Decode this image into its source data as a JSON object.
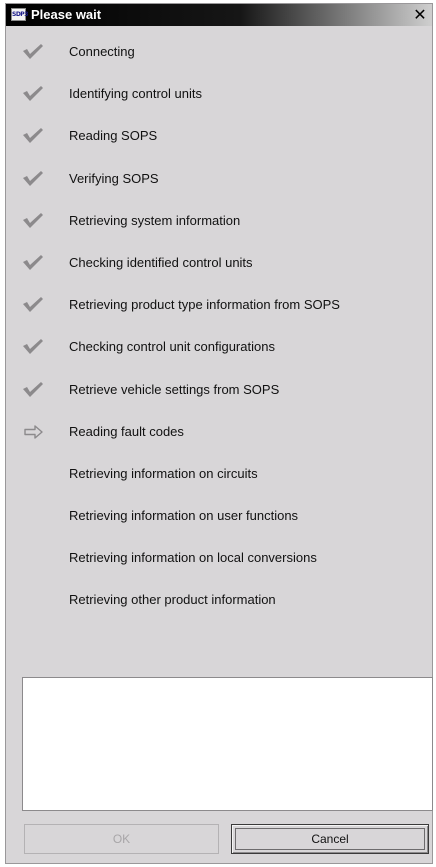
{
  "dialog": {
    "title": "Please wait",
    "app_icon_text": "SDP3",
    "close_glyph": "✕"
  },
  "steps": [
    {
      "label": "Connecting",
      "status": "done"
    },
    {
      "label": "Identifying control units",
      "status": "done"
    },
    {
      "label": "Reading SOPS",
      "status": "done"
    },
    {
      "label": "Verifying SOPS",
      "status": "done"
    },
    {
      "label": "Retrieving system information",
      "status": "done"
    },
    {
      "label": "Checking identified control units",
      "status": "done"
    },
    {
      "label": "Retrieving product type information from SOPS",
      "status": "done"
    },
    {
      "label": "Checking control unit configurations",
      "status": "done"
    },
    {
      "label": "Retrieve vehicle settings from SOPS",
      "status": "done"
    },
    {
      "label": "Reading fault codes",
      "status": "current"
    },
    {
      "label": "Retrieving information on circuits",
      "status": "pending"
    },
    {
      "label": "Retrieving information on user functions",
      "status": "pending"
    },
    {
      "label": "Retrieving information on local conversions",
      "status": "pending"
    },
    {
      "label": "Retrieving other product information",
      "status": "pending"
    }
  ],
  "icons": {
    "done": "checkmark-icon",
    "current": "arrow-right-icon",
    "pending": "none"
  },
  "colors": {
    "checkmark": "#8c8a8c",
    "arrow": "#8c8a8c",
    "dialog_bg": "#d8d6d8"
  },
  "log": {
    "text": ""
  },
  "buttons": {
    "ok_label": "OK",
    "ok_enabled": false,
    "cancel_label": "Cancel"
  }
}
